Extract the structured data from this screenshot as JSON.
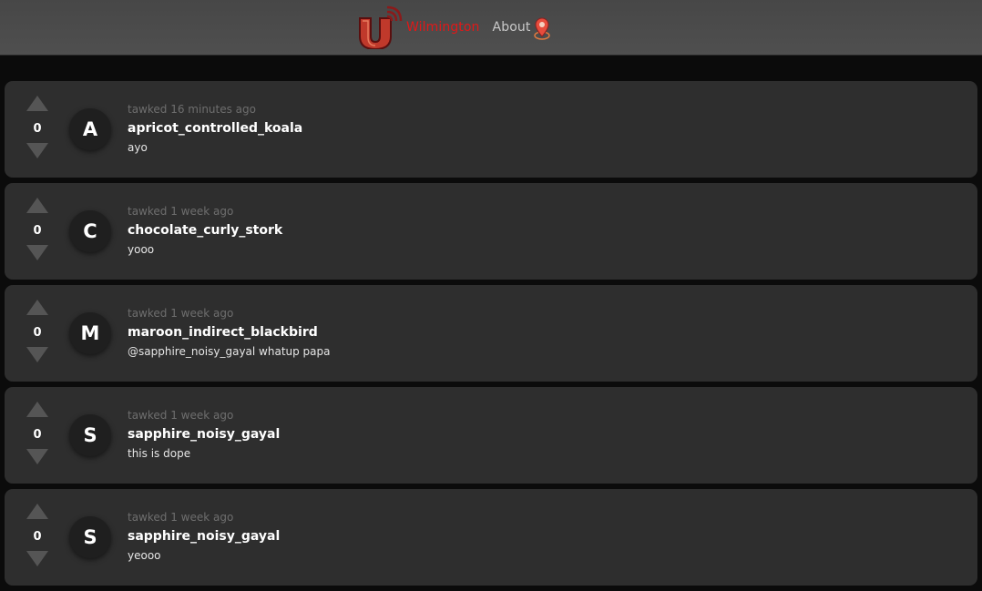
{
  "header": {
    "city": "Wilmington",
    "about_label": "About",
    "accent_color": "#e01818"
  },
  "posts": [
    {
      "time": "tawked 16 minutes ago",
      "initial": "A",
      "username": "apricot_controlled_koala",
      "message": "ayo",
      "votes": "0"
    },
    {
      "time": "tawked 1 week ago",
      "initial": "C",
      "username": "chocolate_curly_stork",
      "message": "yooo",
      "votes": "0"
    },
    {
      "time": "tawked 1 week ago",
      "initial": "M",
      "username": "maroon_indirect_blackbird",
      "message": "@sapphire_noisy_gayal whatup papa",
      "votes": "0"
    },
    {
      "time": "tawked 1 week ago",
      "initial": "S",
      "username": "sapphire_noisy_gayal",
      "message": "this is dope",
      "votes": "0"
    },
    {
      "time": "tawked 1 week ago",
      "initial": "S",
      "username": "sapphire_noisy_gayal",
      "message": "yeooo",
      "votes": "0"
    }
  ],
  "icons": {
    "logo": "tawk-u-logo-icon",
    "about": "location-pin-icon",
    "upvote": "upvote-arrow-icon",
    "downvote": "downvote-arrow-icon"
  }
}
